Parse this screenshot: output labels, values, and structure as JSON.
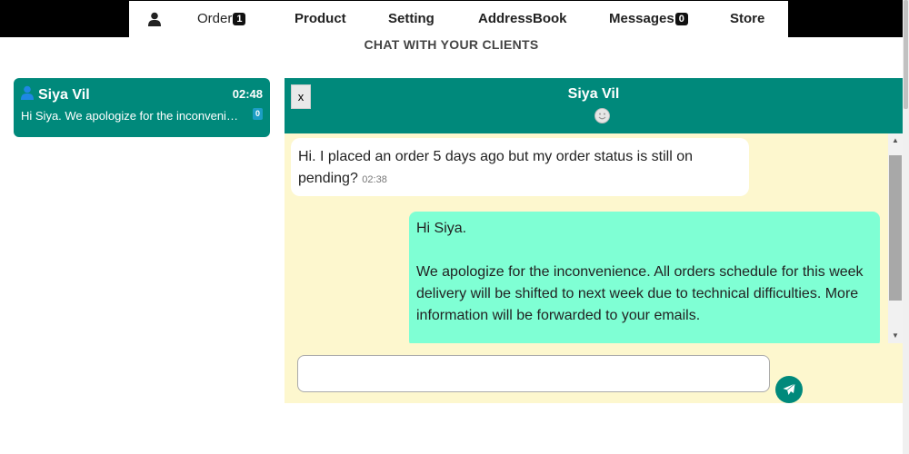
{
  "nav": {
    "items": [
      {
        "label": "Order",
        "badge": "1"
      },
      {
        "label": "Product"
      },
      {
        "label": "Setting"
      },
      {
        "label": "AddressBook"
      },
      {
        "label": "Messages",
        "badge": "0"
      },
      {
        "label": "Store"
      }
    ],
    "user_icon": "person-icon"
  },
  "page": {
    "title": "CHAT WITH YOUR CLIENTS"
  },
  "conversations": [
    {
      "name": "Siya Vil",
      "time": "02:48",
      "preview": "Hi Siya. We apologize for the inconvenience. All orders schedule for this week",
      "unread": "0",
      "icon": "person-icon"
    }
  ],
  "chat": {
    "close_label": "x",
    "title": "Siya Vil",
    "status_icon": "smiley-icon",
    "messages": [
      {
        "direction": "incoming",
        "text": "Hi. I placed an order 5 days ago but my order status is still on pending?",
        "time": "02:38"
      },
      {
        "direction": "outgoing",
        "line1": "Hi Siya.",
        "line2": "We apologize for the inconvenience. All orders schedule for this week delivery will be shifted to next week due to technical difficulties. More information will be forwarded to your emails."
      }
    ],
    "input_value": "",
    "send_icon": "paper-plane-icon"
  },
  "colors": {
    "accent": "#00897b",
    "chat_bg": "#fdf7ce",
    "outgoing_bubble": "#7fffd4",
    "incoming_bubble": "#ffffff",
    "nav_bg": "#000000"
  }
}
